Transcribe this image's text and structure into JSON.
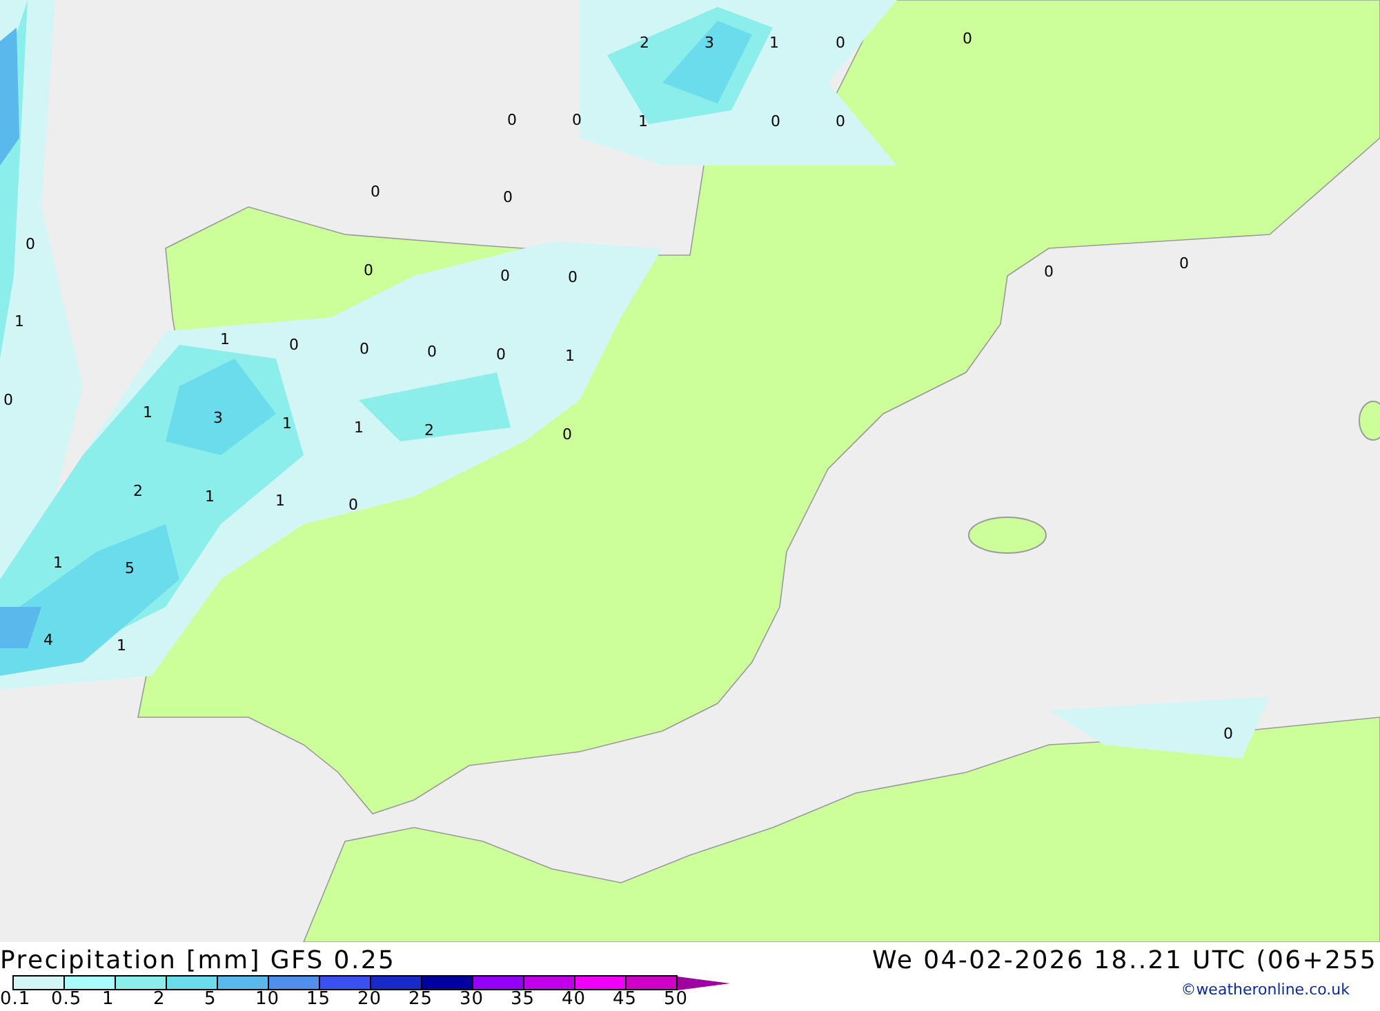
{
  "map": {
    "labels": [
      "2",
      "3",
      "1",
      "0",
      "0",
      "0",
      "0",
      "1",
      "0",
      "0",
      "0",
      "0",
      "0",
      "0",
      "0",
      "0",
      "0",
      "0",
      "1",
      "1",
      "0",
      "0",
      "0",
      "0",
      "1",
      "0",
      "1",
      "3",
      "1",
      "1",
      "2",
      "0",
      "2",
      "1",
      "1",
      "0",
      "1",
      "5",
      "4",
      "1",
      "0"
    ]
  },
  "title": "Precipitation [mm] GFS 0.25",
  "valid_time": "We 04-02-2026 18..21 UTC (06+255",
  "legend": {
    "swatches": [
      {
        "color": "#d2f6f6"
      },
      {
        "color": "#aafcfc"
      },
      {
        "color": "#8ceeea"
      },
      {
        "color": "#6adcec"
      },
      {
        "color": "#5ab8ec"
      },
      {
        "color": "#5090ec"
      },
      {
        "color": "#3a50f0"
      },
      {
        "color": "#1a2ac8"
      },
      {
        "color": "#0000a0"
      },
      {
        "color": "#9400f8"
      },
      {
        "color": "#c000e8"
      },
      {
        "color": "#f000f8"
      },
      {
        "color": "#d000c8"
      }
    ],
    "ticks": [
      "0.1",
      "0.5",
      "1",
      "2",
      "5",
      "10",
      "15",
      "20",
      "25",
      "30",
      "35",
      "40",
      "45",
      "50"
    ]
  },
  "copyright": "©weatheronline.co.uk"
}
